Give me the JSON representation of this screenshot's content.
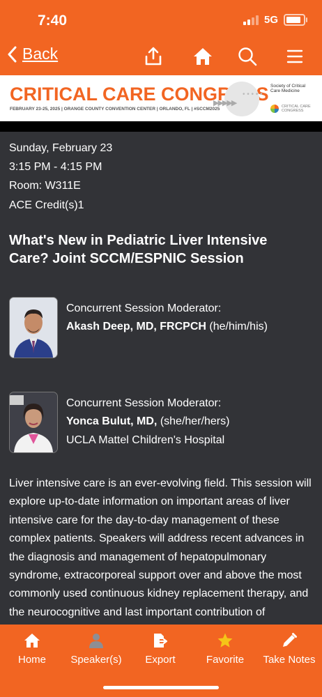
{
  "status": {
    "time": "7:40",
    "network": "5G"
  },
  "nav": {
    "back_label": "Back"
  },
  "banner": {
    "title": "CRITICAL CARE CONGRESS",
    "subtitle": "FEBRUARY 23-25, 2025 | ORANGE COUNTY CONVENTION CENTER | ORLANDO, FL | #SCCM2025",
    "sccm_name": "Society of Critical Care Medicine",
    "ccc_name": "CRITICAL CARE CONGRESS"
  },
  "session": {
    "date": "Sunday, February 23",
    "time": "3:15 PM - 4:15 PM",
    "room": "Room: W311E",
    "credits": "ACE Credit(s)1",
    "title": "What's New in Pediatric Liver Intensive Care? Joint SCCM/ESPNIC Session"
  },
  "moderators": [
    {
      "role": "Concurrent Session Moderator:",
      "name": "Akash Deep, MD, FRCPCH",
      "pronouns": " (he/him/his)",
      "affiliation": ""
    },
    {
      "role": "Concurrent Session Moderator:",
      "name": "Yonca Bulut, MD,",
      "pronouns": " (she/her/hers)",
      "affiliation": "UCLA Mattel Children's Hospital"
    }
  ],
  "description": "Liver intensive care is an ever-evolving field. This session will explore up-to-date information on important areas of liver intensive care for the day-to-day management of these complex patients. Speakers will address recent advances in the diagnosis and management of hepatopulmonary syndrome, extracorporeal support over and above the most commonly used continuous kidney replacement therapy, and the neurocognitive and last important contribution of",
  "tabs": [
    {
      "label": "Home",
      "icon": "home-icon"
    },
    {
      "label": "Speaker(s)",
      "icon": "person-icon"
    },
    {
      "label": "Export",
      "icon": "export-icon"
    },
    {
      "label": "Favorite",
      "icon": "star-icon"
    },
    {
      "label": "Take Notes",
      "icon": "pencil-icon"
    }
  ],
  "colors": {
    "brand": "#F26522",
    "background": "#323337",
    "favorite": "#F5C518",
    "speaker_icon": "#8E8E93"
  }
}
